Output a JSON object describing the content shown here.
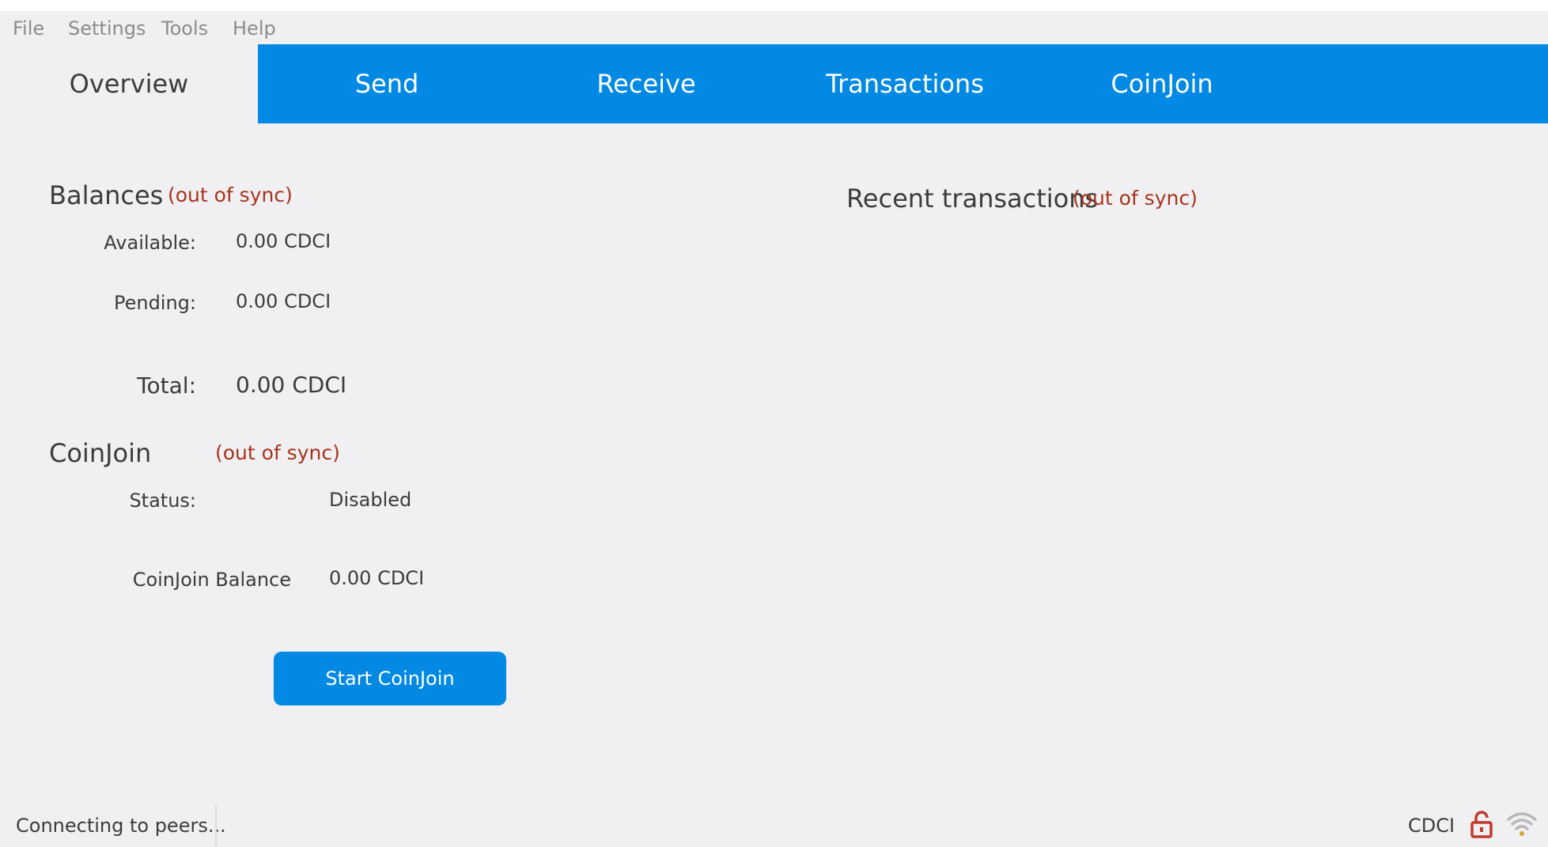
{
  "menu": {
    "file": "File",
    "settings": "Settings",
    "tools": "Tools",
    "help": "Help"
  },
  "tabs": {
    "overview": "Overview",
    "send": "Send",
    "receive": "Receive",
    "transactions": "Transactions",
    "coinjoin": "CoinJoin"
  },
  "balances": {
    "title": "Balances",
    "sync_warning": "(out of sync)",
    "available_label": "Available:",
    "available_value": "0.00 CDCI",
    "pending_label": "Pending:",
    "pending_value": "0.00 CDCI",
    "total_label": "Total:",
    "total_value": "0.00 CDCI"
  },
  "coinjoin": {
    "title": "CoinJoin",
    "sync_warning": "(out of sync)",
    "status_label": "Status:",
    "status_value": "Disabled",
    "balance_label": "CoinJoin Balance",
    "balance_value": "0.00 CDCI",
    "start_button": "Start CoinJoin"
  },
  "recent": {
    "title": "Recent transactions",
    "sync_warning": "(out of sync)"
  },
  "statusbar": {
    "text": "Connecting to peers...",
    "unit": "CDCI",
    "icons": [
      "lock-open-icon",
      "wifi-icon"
    ]
  },
  "colors": {
    "accent": "#0189e3",
    "warning": "#a8331c",
    "background": "#f0f0f3",
    "lock": "#c0392b",
    "wifi": "#b8b8b8"
  }
}
